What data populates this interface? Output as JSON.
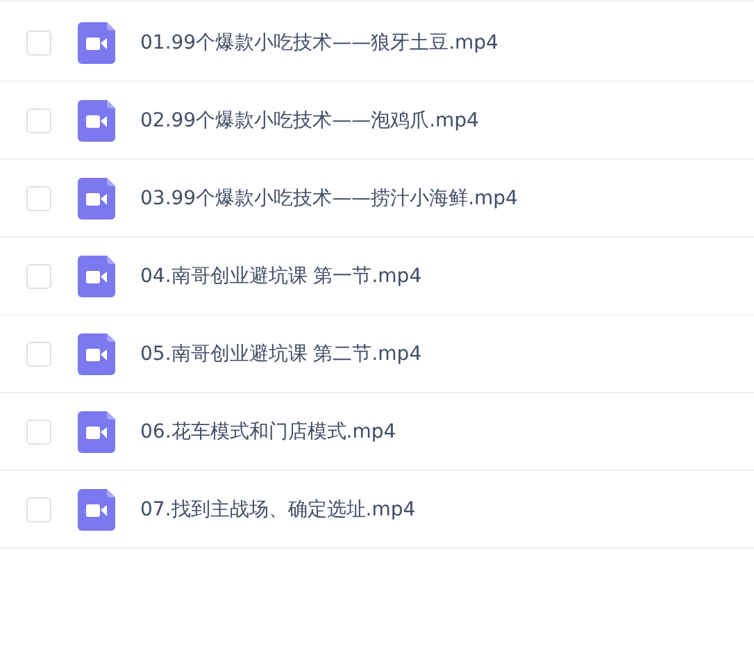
{
  "files": [
    {
      "name": "01.99个爆款小吃技术——狼牙土豆.mp4",
      "checked": false
    },
    {
      "name": "02.99个爆款小吃技术——泡鸡爪.mp4",
      "checked": false
    },
    {
      "name": "03.99个爆款小吃技术——捞汁小海鲜.mp4",
      "checked": false
    },
    {
      "name": "04.南哥创业避坑课 第一节.mp4",
      "checked": false
    },
    {
      "name": "05.南哥创业避坑课 第二节.mp4",
      "checked": false
    },
    {
      "name": "06.花车模式和门店模式.mp4",
      "checked": false
    },
    {
      "name": "07.找到主战场、确定选址.mp4",
      "checked": false
    }
  ]
}
